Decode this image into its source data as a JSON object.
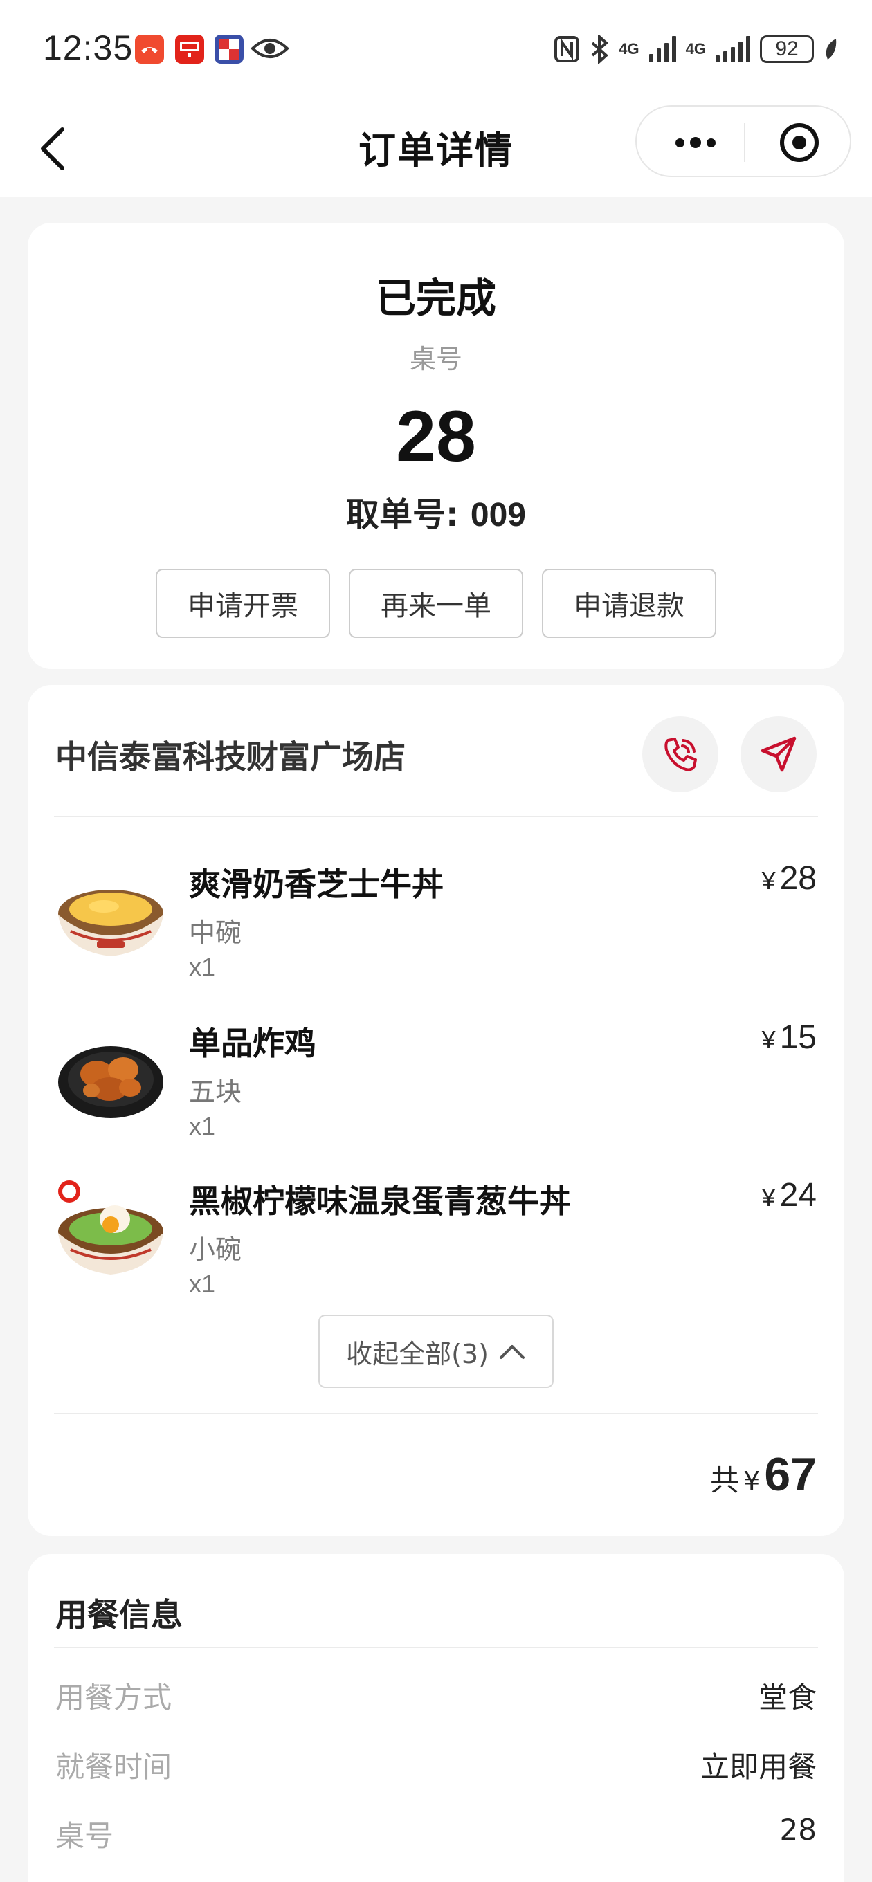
{
  "status_bar": {
    "time": "12:35",
    "app_icons": [
      {
        "name": "missed-call-icon",
        "color": "#f04a2f"
      },
      {
        "name": "news-app-icon",
        "color": "#e2231a"
      },
      {
        "name": "game-app-icon",
        "color": "#3a4fa8"
      }
    ],
    "network_label_1": "4G",
    "network_label_2": "4G",
    "battery": "92"
  },
  "nav": {
    "title": "订单详情"
  },
  "order": {
    "state": "已完成",
    "table_label": "桌号",
    "table_number": "28",
    "pickup_label": "取单号: ",
    "pickup_number": "009",
    "actions": [
      "申请开票",
      "再来一单",
      "申请退款"
    ]
  },
  "store": {
    "name": "中信泰富科技财富广场店",
    "accent_color": "#c8102e"
  },
  "items": [
    {
      "name": "爽滑奶香芝士牛丼",
      "spec": "中碗",
      "qty": "x1",
      "currency": "¥",
      "price": "28"
    },
    {
      "name": "单品炸鸡",
      "spec": "五块",
      "qty": "x1",
      "currency": "¥",
      "price": "15"
    },
    {
      "name": "黑椒柠檬味温泉蛋青葱牛丼",
      "spec": "小碗",
      "qty": "x1",
      "currency": "¥",
      "price": "24"
    }
  ],
  "collapse_label": "收起全部(3)",
  "total": {
    "label": "共",
    "currency": "¥",
    "value": "67"
  },
  "dining_info": {
    "title": "用餐信息",
    "rows": [
      {
        "key": "用餐方式",
        "value": "堂食"
      },
      {
        "key": "就餐时间",
        "value": "立即用餐"
      },
      {
        "key": "桌号",
        "value": "28"
      }
    ]
  }
}
